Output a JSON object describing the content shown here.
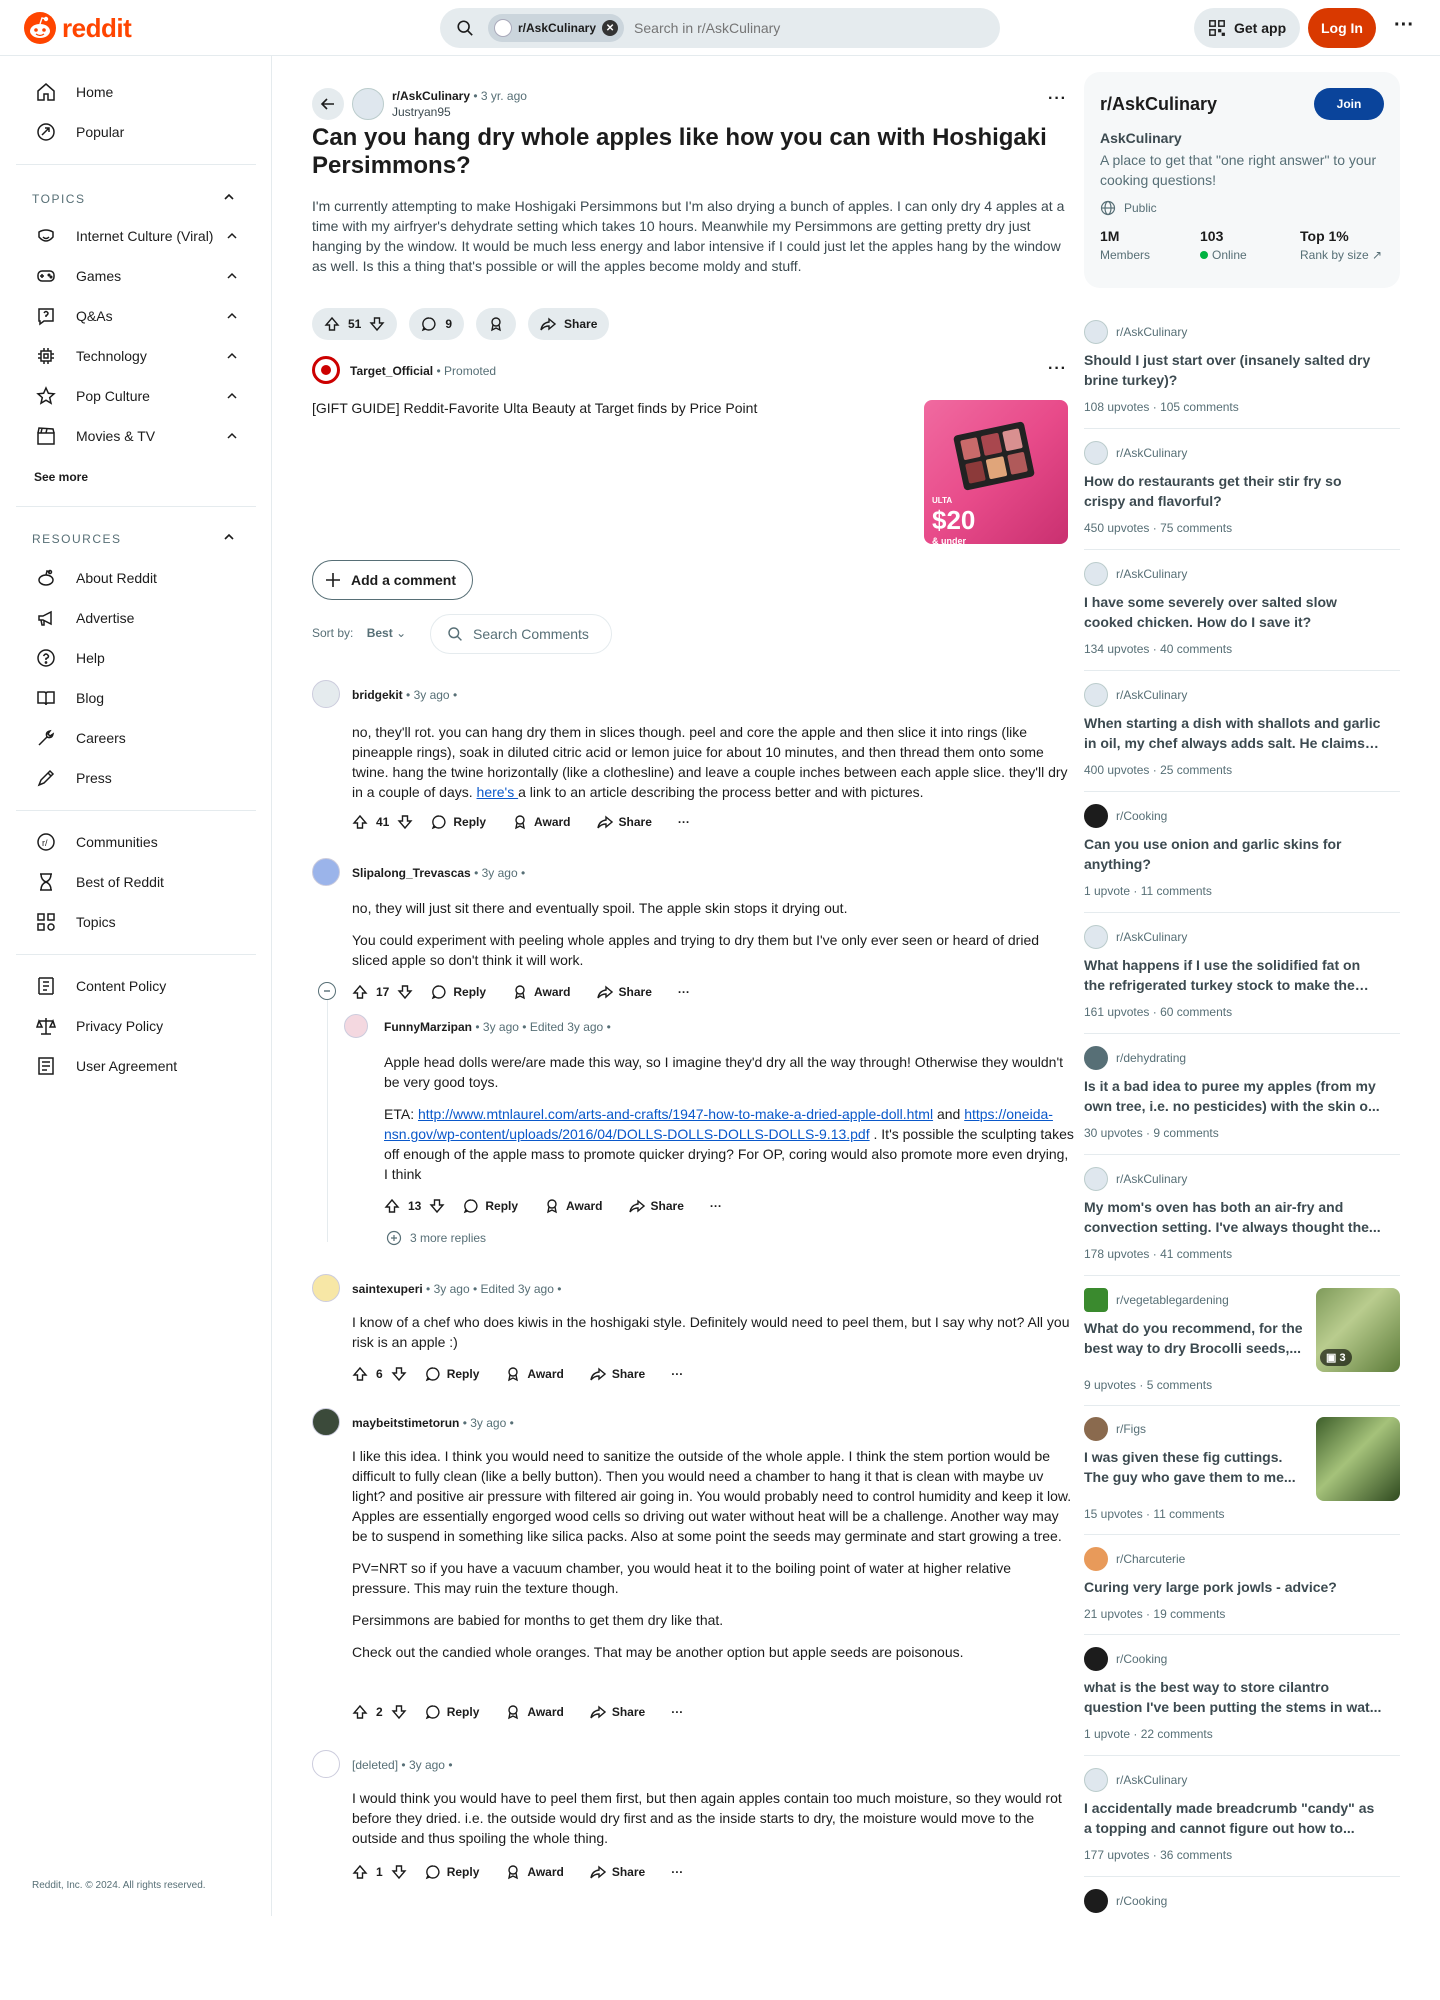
{
  "header": {
    "logo_text": "reddit",
    "search_chip": "r/AskCulinary",
    "search_placeholder": "Search in r/AskCulinary",
    "get_app": "Get app",
    "login": "Log In"
  },
  "sidebar": {
    "top": [
      {
        "label": "Home",
        "icon": "home-icon"
      },
      {
        "label": "Popular",
        "icon": "popular-icon"
      }
    ],
    "topics_title": "TOPICS",
    "topics": [
      {
        "label": "Internet Culture (Viral)",
        "icon": "smile-icon"
      },
      {
        "label": "Games",
        "icon": "gamepad-icon"
      },
      {
        "label": "Q&As",
        "icon": "question-icon"
      },
      {
        "label": "Technology",
        "icon": "chip-icon"
      },
      {
        "label": "Pop Culture",
        "icon": "star-icon"
      },
      {
        "label": "Movies & TV",
        "icon": "clapper-icon"
      }
    ],
    "see_more": "See more",
    "resources_title": "RESOURCES",
    "resources": [
      {
        "label": "About Reddit",
        "icon": "reddit-icon"
      },
      {
        "label": "Advertise",
        "icon": "megaphone-icon"
      },
      {
        "label": "Help",
        "icon": "help-icon"
      },
      {
        "label": "Blog",
        "icon": "book-icon"
      },
      {
        "label": "Careers",
        "icon": "wrench-icon"
      },
      {
        "label": "Press",
        "icon": "pen-icon"
      }
    ],
    "community": [
      {
        "label": "Communities",
        "icon": "communities-icon"
      },
      {
        "label": "Best of Reddit",
        "icon": "hourglass-icon"
      },
      {
        "label": "Topics",
        "icon": "grid-icon"
      }
    ],
    "policies": [
      {
        "label": "Content Policy",
        "icon": "policy-icon"
      },
      {
        "label": "Privacy Policy",
        "icon": "scales-icon"
      },
      {
        "label": "User Agreement",
        "icon": "document-icon"
      }
    ],
    "copyright": "Reddit, Inc. © 2024. All rights reserved."
  },
  "post": {
    "subreddit": "r/AskCulinary",
    "age": "3 yr. ago",
    "author": "Justryan95",
    "title": "Can you hang dry whole apples like how you can with Hoshigaki Persimmons?",
    "body": "I'm currently attempting to make Hoshigaki Persimmons but I'm also drying a bunch of apples. I can only dry 4 apples at a time with my airfryer's dehydrate setting which takes 10 hours. Meanwhile my Persimmons are getting pretty dry just hanging by the window. It would be much less energy and labor intensive if I could just let the apples hang by the window as well. Is this a thing that's possible or will the apples become moldy and stuff.",
    "votes": "51",
    "comments": "9",
    "share": "Share"
  },
  "promoted": {
    "author": "Target_Official",
    "tag": "Promoted",
    "text": "[GIFT GUIDE] Reddit-Favorite Ulta Beauty at Target finds by Price Point",
    "price": "$20",
    "price_sub": "& under",
    "brand": "ULTA"
  },
  "comment_bar": {
    "add": "Add a comment",
    "sort_label": "Sort by:",
    "sort_value": "Best",
    "search": "Search Comments"
  },
  "labels": {
    "reply": "Reply",
    "award": "Award",
    "share": "Share",
    "more_replies": "3 more replies",
    "dot": "•"
  },
  "comments": [
    {
      "author": "bridgekit",
      "age": "3y ago",
      "votes": "41",
      "text": "no, they'll rot. you can hang dry them in slices though. peel and core the apple and then slice it into rings (like pineapple rings), soak in diluted citric acid or lemon juice for about 10 minutes, and then thread them onto some twine. hang the twine horizontally (like a clothesline) and leave a couple inches between each apple slice. they'll dry in a couple of days. ",
      "link": "here's ",
      "text_after": "a link to an article describing the process better and with pictures."
    },
    {
      "author": "Slipalong_Trevascas",
      "age": "3y ago",
      "votes": "17",
      "p1": "no, they will just sit there and eventually spoil. The apple skin stops it drying out.",
      "p2": "You could experiment with peeling whole apples and trying to dry them but I've only ever seen or heard of dried sliced apple so don't think it will work."
    },
    {
      "author": "FunnyMarzipan",
      "age": "3y ago",
      "edited": "Edited 3y ago",
      "votes": "13",
      "p1": "Apple head dolls were/are made this way, so I imagine they'd dry all the way through! Otherwise they wouldn't be very good toys.",
      "eta": "ETA: ",
      "link1": "http://www.mtnlaurel.com/arts-and-crafts/1947-how-to-make-a-dried-apple-doll.html",
      "and": " and ",
      "link2": "https://oneida-nsn.gov/wp-content/uploads/2016/04/DOLLS-DOLLS-DOLLS-DOLLS-9.13.pdf",
      "p2_after": " . It's possible the sculpting takes off enough of the apple mass to promote quicker drying? For OP, coring would also promote more even drying, I think"
    },
    {
      "author": "saintexuperi",
      "age": "3y ago",
      "edited": "Edited 3y ago",
      "votes": "6",
      "p1": "I know of a chef who does kiwis in the hoshigaki style. Definitely would need to peel them, but I say why not? All you risk is an apple :)"
    },
    {
      "author": "maybeitstimetorun",
      "age": "3y ago",
      "votes": "2",
      "p1": "I like this idea. I think you would need to sanitize the outside of the whole apple. I think the stem portion would be difficult to fully clean (like a belly button). Then you would need a chamber to hang it that is clean with maybe uv light? and positive air pressure with filtered air going in. You would probably need to control humidity and keep it low. Apples are essentially engorged wood cells so driving out water without heat will be a challenge. Another way may be to suspend in something like silica packs. Also at some point the seeds may germinate and start growing a tree.",
      "p2": "PV=NRT so if you have a vacuum chamber, you would heat it to the boiling point of water at higher relative pressure. This may ruin the texture though.",
      "p3": "Persimmons are babied for months to get them dry like that.",
      "p4": "Check out the candied whole oranges. That may be another option but apple seeds are poisonous."
    },
    {
      "author": "[deleted]",
      "age": "3y ago",
      "votes": "1",
      "p1": "I would think you would have to peel them first, but then again apples contain too much moisture, so they would rot before they dried. i.e. the outside would dry first and as the inside starts to dry, the moisture would move to the outside and thus spoiling the whole thing."
    }
  ],
  "about": {
    "title": "r/AskCulinary",
    "join": "Join",
    "name": "AskCulinary",
    "desc": "A place to get that \"one right answer\" to your cooking questions!",
    "public": "Public",
    "members": "1M",
    "members_label": "Members",
    "online": "103",
    "online_label": "Online",
    "rank": "Top 1%",
    "rank_label": "Rank by size"
  },
  "related": [
    {
      "sub": "r/AskCulinary",
      "title": "Should I just start over (insanely salted dry brine turkey)?",
      "upvotes": "108 upvotes",
      "comments": "105 comments"
    },
    {
      "sub": "r/AskCulinary",
      "title": "How do restaurants get their stir fry so crispy and flavorful?",
      "upvotes": "450 upvotes",
      "comments": "75 comments"
    },
    {
      "sub": "r/AskCulinary",
      "title": "I have some severely over salted slow cooked chicken. How do I save it?",
      "upvotes": "134 upvotes",
      "comments": "40 comments"
    },
    {
      "sub": "r/AskCulinary",
      "title": "When starting a dish with shallots and garlic in oil, my chef always adds salt. He claims it...",
      "upvotes": "400 upvotes",
      "comments": "25 comments"
    },
    {
      "sub": "r/Cooking",
      "title": "Can you use onion and garlic skins for anything?",
      "upvotes": "1 upvote",
      "comments": "11 comments"
    },
    {
      "sub": "r/AskCulinary",
      "title": "What happens if I use the solidified fat on the refrigerated turkey stock to make the roux t...",
      "upvotes": "161 upvotes",
      "comments": "60 comments"
    },
    {
      "sub": "r/dehydrating",
      "title": "Is it a bad idea to puree my apples (from my own tree, i.e. no pesticides) with the skin o...",
      "upvotes": "30 upvotes",
      "comments": "9 comments"
    },
    {
      "sub": "r/AskCulinary",
      "title": "My mom's oven has both an air-fry and convection setting. I've always thought the...",
      "upvotes": "178 upvotes",
      "comments": "41 comments"
    },
    {
      "sub": "r/vegetablegardening",
      "title": "What do you recommend, for the best way to dry Brocolli seeds,...",
      "upvotes": "9 upvotes",
      "comments": "5 comments",
      "thumb_count": "3"
    },
    {
      "sub": "r/Figs",
      "title": "I was given these fig cuttings. The guy who gave them to me...",
      "upvotes": "15 upvotes",
      "comments": "11 comments"
    },
    {
      "sub": "r/Charcuterie",
      "title": "Curing very large pork jowls - advice?",
      "upvotes": "21 upvotes",
      "comments": "19 comments"
    },
    {
      "sub": "r/Cooking",
      "title": "what is the best way to store cilantro question I've been putting the stems in wat...",
      "upvotes": "1 upvote",
      "comments": "22 comments"
    },
    {
      "sub": "r/AskCulinary",
      "title": "I accidentally made breadcrumb \"candy\" as a topping and cannot figure out how to...",
      "upvotes": "177 upvotes",
      "comments": "36 comments"
    },
    {
      "sub": "r/Cooking"
    }
  ]
}
